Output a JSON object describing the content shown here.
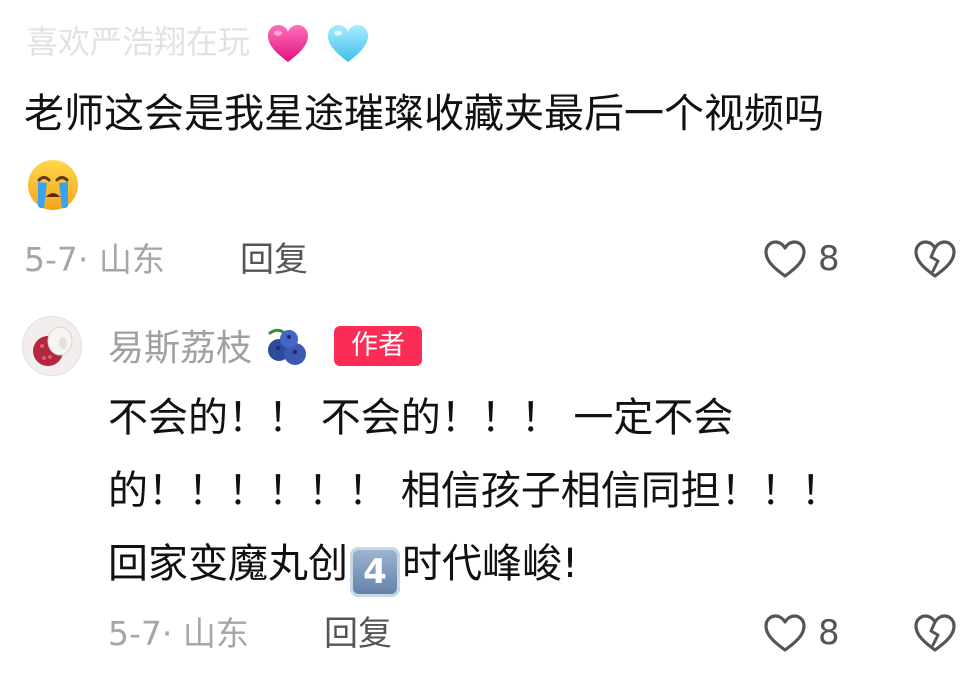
{
  "comment1": {
    "faded_line_text": "喜欢严浩翔在玩",
    "text_line1": "老师这会是我星途璀璨收藏夹最后一个视频吗",
    "date_location": "5-7· 山东",
    "reply_label": "回复",
    "like_count": "8"
  },
  "comment2": {
    "username": "易斯荔枝",
    "author_badge": "作者",
    "text_line1": "不会的！！ 不会的！！！ 一定不会",
    "text_line2": "的！！！！！！ 相信孩子相信同担！！！",
    "text_line3a": "回家变魔丸创",
    "keycap": "4",
    "text_line3b": "时代峰峻!",
    "date_location": "5-7· 山东",
    "reply_label": "回复",
    "like_count": "8"
  },
  "colors": {
    "badge": "#fb2c55",
    "meta_gray": "#a6a6a6",
    "heart_pink": "#f0348f",
    "heart_blue": "#6fd3f1"
  },
  "icons": [
    "pink-heart-icon",
    "light-blue-heart-icon",
    "crying-face-icon",
    "like-heart-icon",
    "broken-heart-icon",
    "blueberry-icon",
    "keycap-4-icon",
    "lychee-avatar"
  ]
}
